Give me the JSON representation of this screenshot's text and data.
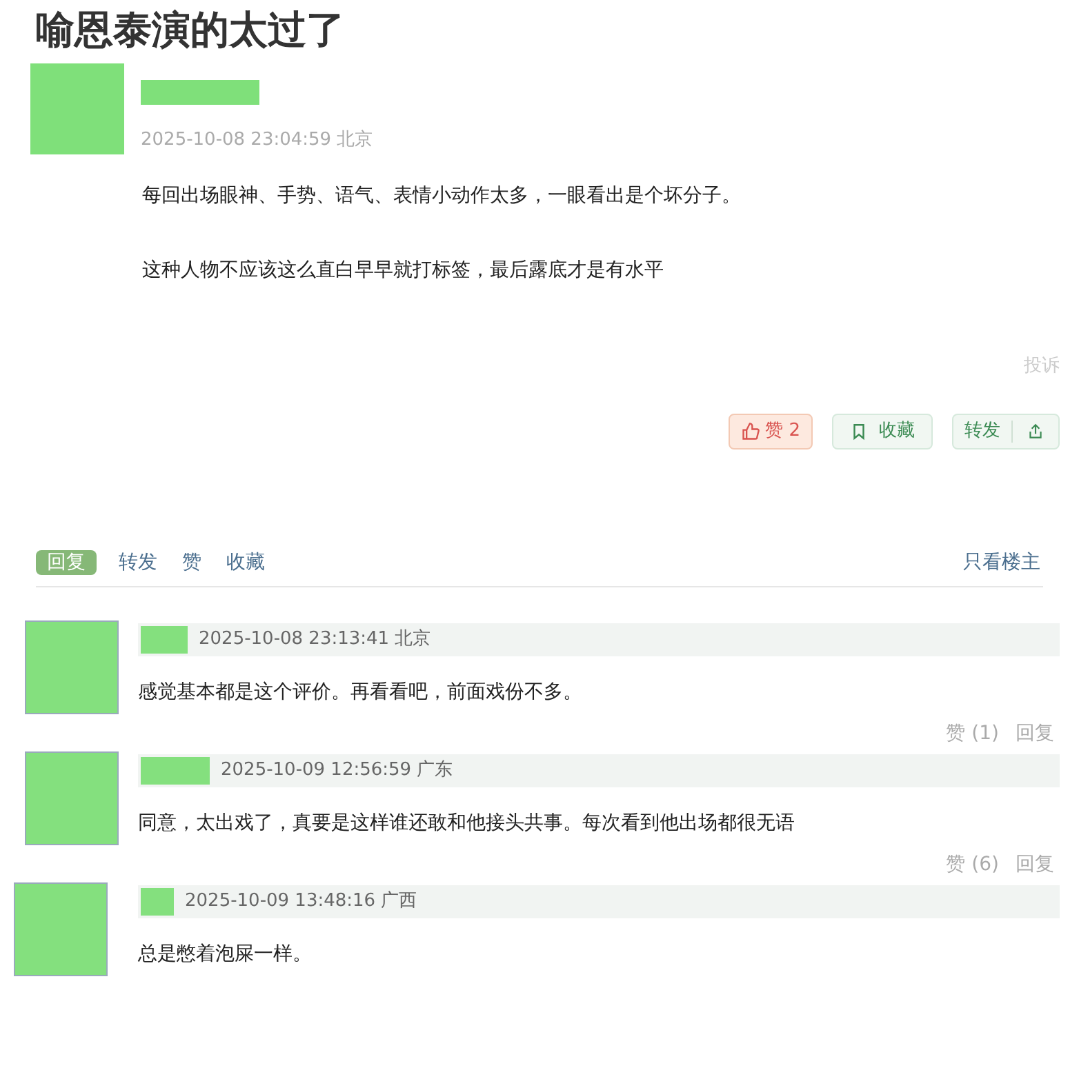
{
  "title": "喻恩泰演的太过了",
  "post": {
    "meta": "2025-10-08 23:04:59 北京",
    "paragraphs": [
      "每回出场眼神、手势、语气、表情小动作太多，一眼看出是个坏分子。",
      "这种人物不应该这么直白早早就打标签，最后露底才是有水平"
    ],
    "report": "投诉",
    "actions": [
      {
        "kind": "like",
        "label": "赞 2"
      },
      {
        "kind": "collect",
        "label": "收藏"
      },
      {
        "kind": "forward",
        "label": "转发"
      }
    ]
  },
  "tabs": [
    {
      "label": "回复",
      "selected": true
    },
    {
      "label": "转发",
      "selected": false
    },
    {
      "label": "赞",
      "selected": false
    },
    {
      "label": "收藏",
      "selected": false
    }
  ],
  "only_op": "只看楼主",
  "replies": [
    {
      "meta": "2025-10-08 23:13:41 北京",
      "text": "感觉基本都是这个评价。再看看吧，前面戏份不多。",
      "like": "赞 (1)",
      "reply": "回复"
    },
    {
      "meta": "2025-10-09 12:56:59 广东",
      "text": "同意，太出戏了，真要是这样谁还敢和他接头共事。每次看到他出场都很无语",
      "like": "赞 (6)",
      "reply": "回复"
    },
    {
      "meta": "2025-10-09 13:48:16 广西",
      "text": "总是憋着泡屎一样。"
    }
  ]
}
